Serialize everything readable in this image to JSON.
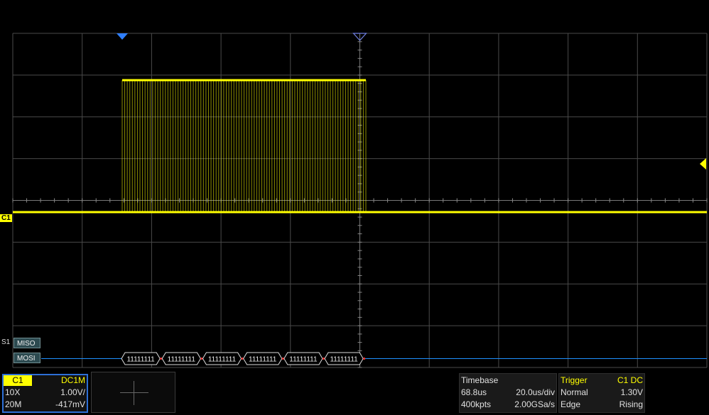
{
  "waveform": {
    "channel_marker": "C1",
    "bus_marker": "S1",
    "bus_lines": [
      "MISO",
      "MOSI"
    ],
    "decoded_frames": [
      "11111111",
      "11111111",
      "11111111",
      "11111111",
      "11111111",
      "11111111"
    ],
    "colors": {
      "trace": "#ffff00",
      "grid": "#4a4a4a",
      "bus": "#1e90ff",
      "marker": "#2f7fff"
    }
  },
  "c1_panel": {
    "channel": "C1",
    "coupling": "DC1M",
    "probe": "10X",
    "vdiv": "1.00V/",
    "bandwidth": "20M",
    "offset": "-417mV"
  },
  "timebase": {
    "title": "Timebase",
    "delay": "68.8us",
    "tdiv": "20.0us/div",
    "memory": "400kpts",
    "sample_rate": "2.00GSa/s"
  },
  "trigger": {
    "title": "Trigger",
    "source": "C1 DC",
    "mode": "Normal",
    "level": "1.30V",
    "type": "Edge",
    "slope": "Rising"
  }
}
